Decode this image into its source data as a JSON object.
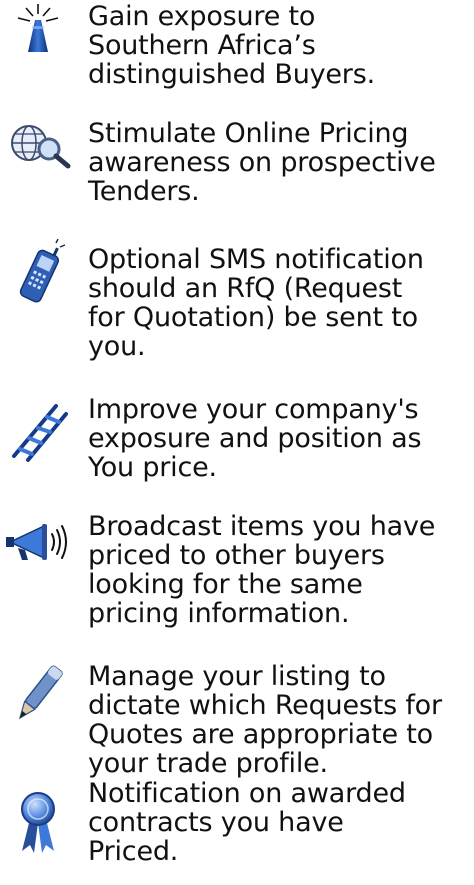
{
  "features": [
    {
      "icon": "lighthouse-icon",
      "text": "Gain exposure to\nSouthern Africa’s\ndistinguished Buyers."
    },
    {
      "icon": "globe-search-icon",
      "text": "Stimulate Online Pricing\nawareness on prospective\nTenders."
    },
    {
      "icon": "mobile-phone-icon",
      "text": "Optional SMS notification\nshould an RfQ (Request\nfor Quotation) be sent to\nyou."
    },
    {
      "icon": "ladder-icon",
      "text": "Improve your company's\nexposure and position as\nYou price."
    },
    {
      "icon": "megaphone-icon",
      "text": "Broadcast items you have\npriced to other buyers\nlooking for the same\npricing information."
    },
    {
      "icon": "pen-icon",
      "text": "Manage your listing to\ndictate which Requests for\nQuotes are appropriate to\nyour trade profile."
    },
    {
      "icon": "award-ribbon-icon",
      "text": "Notification on awarded\ncontracts you have\nPriced."
    }
  ]
}
